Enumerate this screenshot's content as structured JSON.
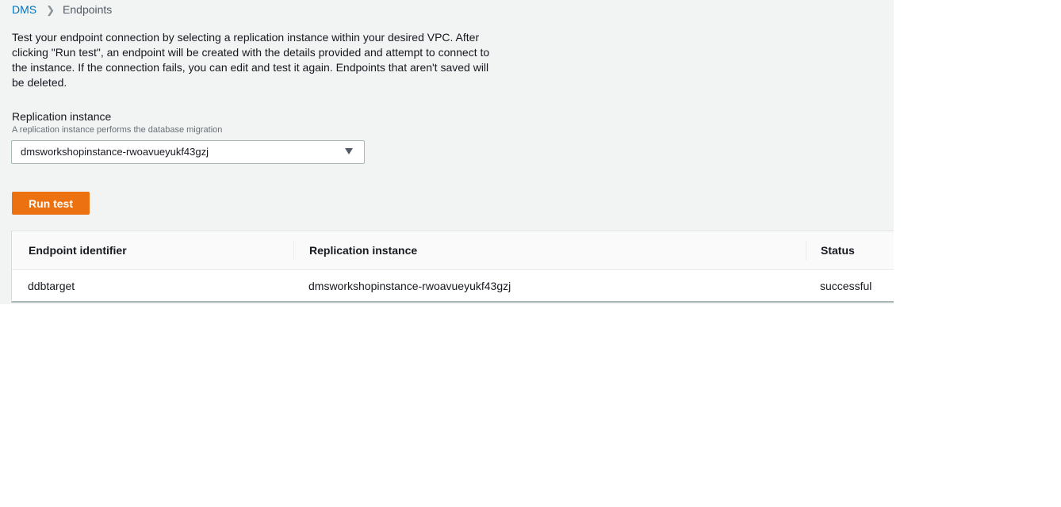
{
  "breadcrumb": {
    "root": "DMS",
    "current": "Endpoints"
  },
  "description": "Test your endpoint connection by selecting a replication instance within your desired VPC. After clicking \"Run test\", an endpoint will be created with the details provided and attempt to connect to the instance. If the connection fails, you can edit and test it again. Endpoints that aren't saved will be deleted.",
  "replication_field": {
    "label": "Replication instance",
    "hint": "A replication instance performs the database migration",
    "selected": "dmsworkshopinstance-rwoavueyukf43gzj"
  },
  "run_test_label": "Run test",
  "table": {
    "headers": [
      "Endpoint identifier",
      "Replication instance",
      "Status"
    ],
    "rows": [
      [
        "ddbtarget",
        "dmsworkshopinstance-rwoavueyukf43gzj",
        "successful"
      ]
    ]
  },
  "colors": {
    "panel_bg": "#f2f3f3",
    "link": "#0073bb",
    "primary_button": "#ec7211"
  },
  "icons": {
    "breadcrumb_separator": "chevron-right-icon",
    "select_caret": "caret-down-icon"
  }
}
